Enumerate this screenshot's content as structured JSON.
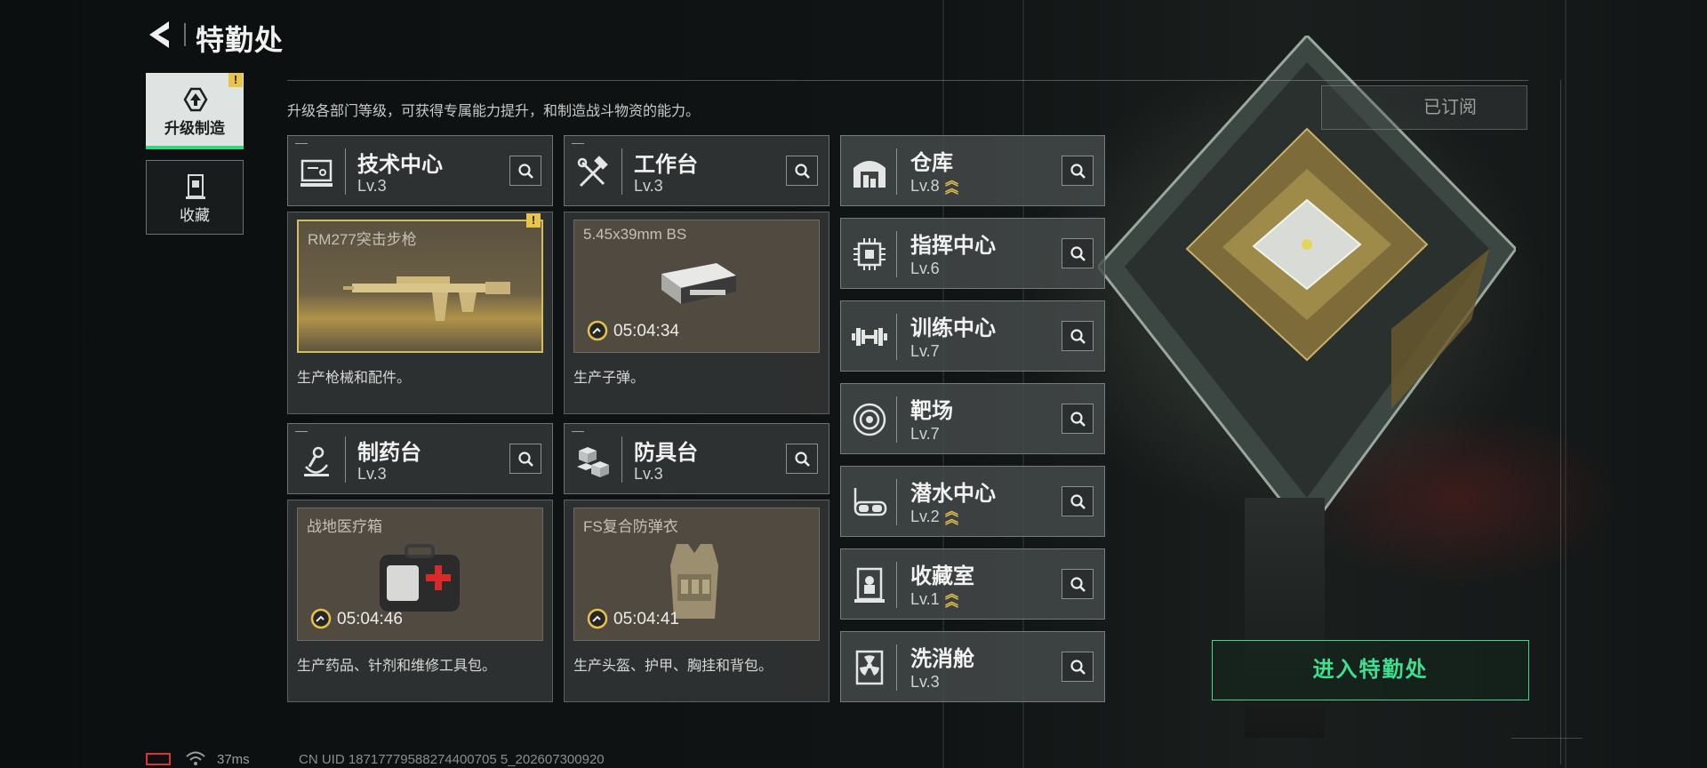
{
  "header": {
    "title": "特勤处"
  },
  "sidebar": {
    "items": [
      {
        "label": "升级制造",
        "active": true,
        "icon": "upgrade-icon",
        "alert": "!"
      },
      {
        "label": "收藏",
        "active": false,
        "icon": "collection-icon"
      }
    ]
  },
  "intro": "升级各部门等级，可获得专属能力提升，和制造战斗物资的能力。",
  "subscribed_label": "已订阅",
  "facilities": [
    {
      "name": "技术中心",
      "level": "Lv.3",
      "icon": "tech-center-icon",
      "product": "RM277突击步枪",
      "timer": "",
      "alert": "!",
      "desc": "生产枪械和配件。"
    },
    {
      "name": "工作台",
      "level": "Lv.3",
      "icon": "workbench-icon",
      "product": "5.45x39mm BS",
      "timer": "05:04:34",
      "desc": "生产子弹。"
    },
    {
      "name": "制药台",
      "level": "Lv.3",
      "icon": "pharmacy-icon",
      "product": "战地医疗箱",
      "timer": "05:04:46",
      "desc": "生产药品、针剂和维修工具包。"
    },
    {
      "name": "防具台",
      "level": "Lv.3",
      "icon": "armor-bench-icon",
      "product": "FS复合防弹衣",
      "timer": "05:04:41",
      "desc": "生产头盔、护甲、胸挂和背包。"
    }
  ],
  "rooms": [
    {
      "name": "仓库",
      "level": "Lv.8",
      "icon": "warehouse-icon",
      "upgradable": true
    },
    {
      "name": "指挥中心",
      "level": "Lv.6",
      "icon": "command-center-icon",
      "upgradable": false
    },
    {
      "name": "训练中心",
      "level": "Lv.7",
      "icon": "training-center-icon",
      "upgradable": false
    },
    {
      "name": "靶场",
      "level": "Lv.7",
      "icon": "shooting-range-icon",
      "upgradable": false
    },
    {
      "name": "潜水中心",
      "level": "Lv.2",
      "icon": "diving-center-icon",
      "upgradable": true
    },
    {
      "name": "收藏室",
      "level": "Lv.1",
      "icon": "collection-room-icon",
      "upgradable": true
    },
    {
      "name": "洗消舱",
      "level": "Lv.3",
      "icon": "decontamination-icon",
      "upgradable": false
    }
  ],
  "enter_button": "进入特勤处",
  "status_bar": {
    "ping": "37ms",
    "uid": "CN UID 18717779588274400705 5_202607300920"
  },
  "colors": {
    "accent_green": "#3fe090",
    "upgrade_gold": "#e3c04d",
    "alert_yellow": "#e8c44a"
  }
}
